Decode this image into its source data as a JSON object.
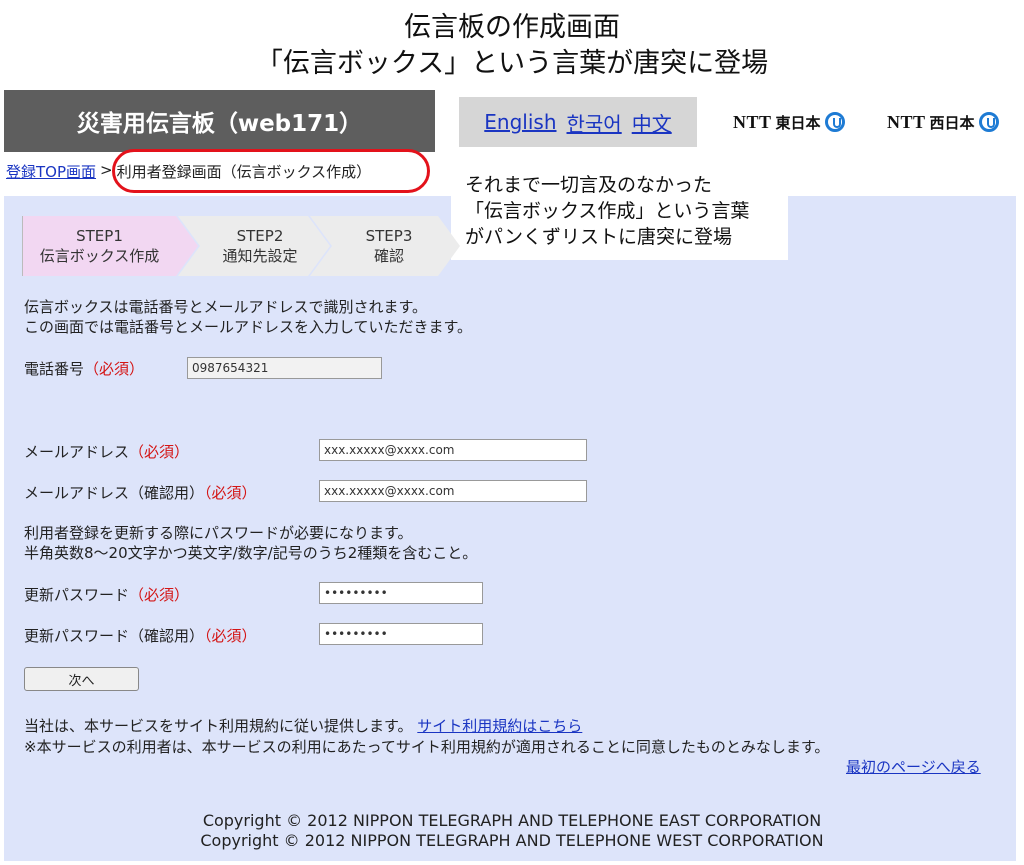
{
  "slide": {
    "title_line1": "伝言板の作成画面",
    "title_line2": "「伝言ボックス」という言葉が唐突に登場"
  },
  "header": {
    "title": "災害用伝言板（web171）"
  },
  "languages": [
    "English",
    "한국어",
    "中文"
  ],
  "logos": [
    {
      "brand": "NTT",
      "region": "東日本",
      "icon": "ntt-logo-icon"
    },
    {
      "brand": "NTT",
      "region": "西日本",
      "icon": "ntt-logo-icon"
    }
  ],
  "breadcrumb": {
    "home_link": "登録TOP画面",
    "separator": ">",
    "current": "利用者登録画面（伝言ボックス作成）"
  },
  "callout": {
    "line1": "それまで一切言及のなかった",
    "line2": "「伝言ボックス作成」という言葉",
    "line3": "がパンくずリストに唐突に登場"
  },
  "steps": [
    {
      "num": "STEP1",
      "label": "伝言ボックス作成",
      "active": true
    },
    {
      "num": "STEP2",
      "label": "通知先設定",
      "active": false
    },
    {
      "num": "STEP3",
      "label": "確認",
      "active": false
    }
  ],
  "intro": {
    "line1": "伝言ボックスは電話番号とメールアドレスで識別されます。",
    "line2": "この画面では電話番号とメールアドレスを入力していただきます。"
  },
  "form": {
    "required_mark": "（必須）",
    "phone_label": "電話番号",
    "phone_value": "0987654321",
    "email_label": "メールアドレス",
    "email_value": "xxx.xxxxx@xxxx.com",
    "email_confirm_label": "メールアドレス（確認用）",
    "email_confirm_value": "xxx.xxxxx@xxxx.com",
    "password_note_line1": "利用者登録を更新する際にパスワードが必要になります。",
    "password_note_line2": "半角英数8～20文字かつ英文字/数字/記号のうち2種類を含むこと。",
    "password_label": "更新パスワード",
    "password_value": "•••••••••",
    "password_confirm_label": "更新パスワード（確認用）",
    "password_confirm_value": "•••••••••",
    "next_button": "次へ"
  },
  "terms": {
    "line1": "当社は、本サービスをサイト利用規約に従い提供します。",
    "terms_link": "サイト利用規約はこちら",
    "line2": "※本サービスの利用者は、本サービスの利用にあたってサイト利用規約が適用されることに同意したものとみなします。",
    "back_link": "最初のページへ戻る"
  },
  "footer": {
    "copyright_east": "Copyright © 2012 NIPPON TELEGRAPH AND TELEPHONE EAST CORPORATION",
    "copyright_west": "Copyright © 2012 NIPPON TELEGRAPH AND TELEPHONE WEST CORPORATION"
  },
  "colors": {
    "header_bg": "#5e5e5e",
    "panel_bg": "#dde4fa",
    "required": "#d41515",
    "link": "#1a35c2",
    "highlight": "#e3121b",
    "active_step": "#f2d7f2"
  }
}
